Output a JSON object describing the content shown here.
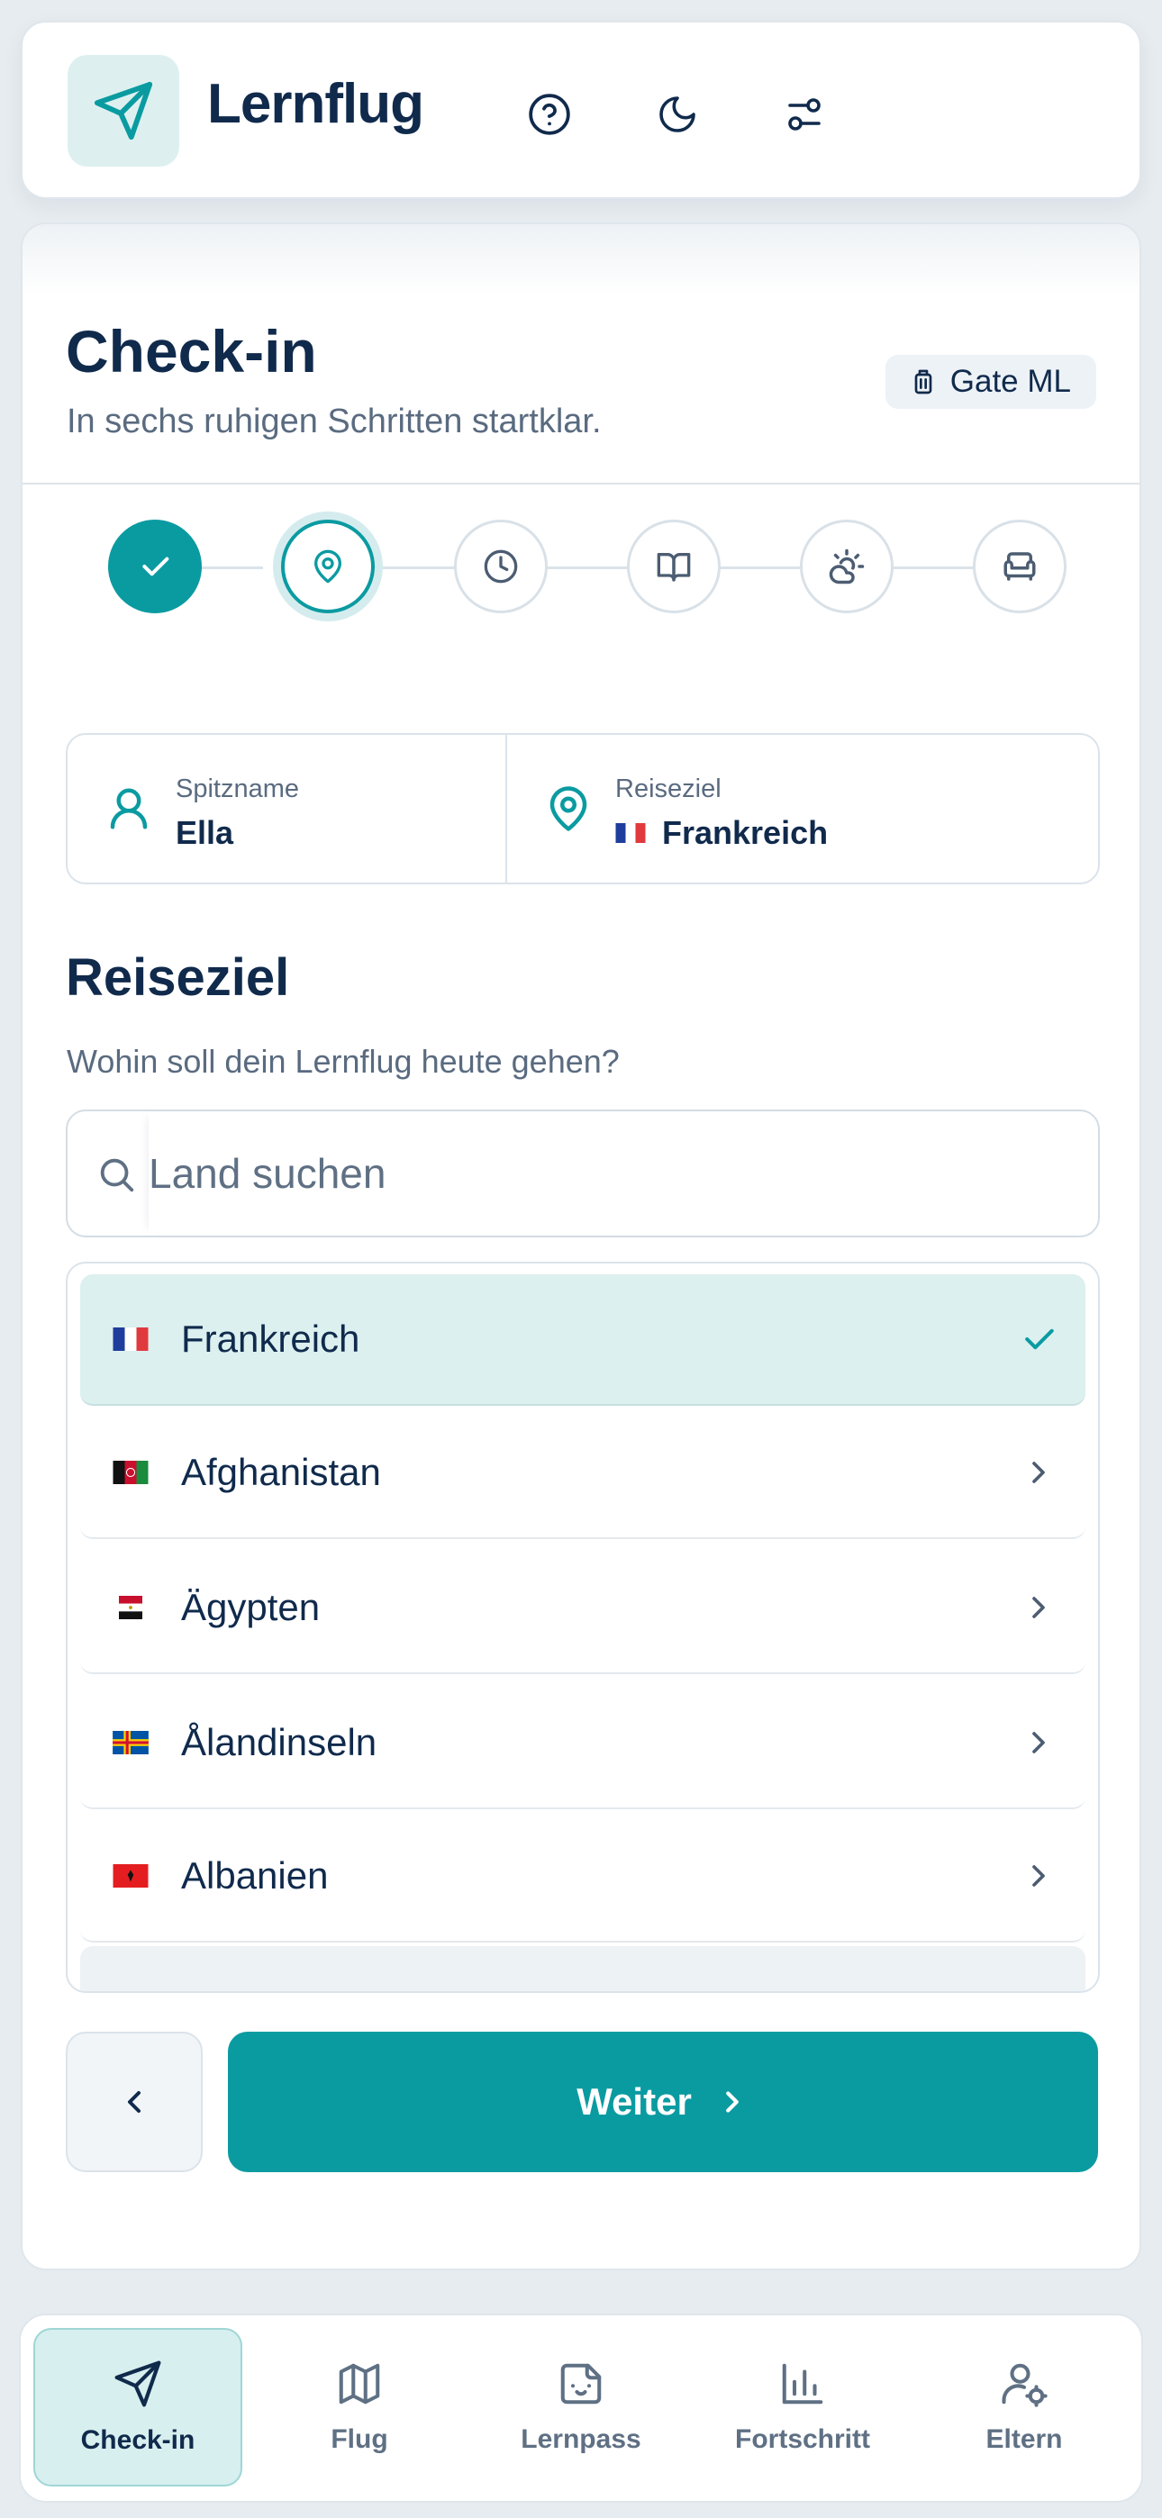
{
  "app": {
    "title": "Lernflug"
  },
  "header": {
    "icons": [
      "help-circle-icon",
      "moon-icon",
      "sliders-icon"
    ]
  },
  "checkin": {
    "title": "Check-in",
    "subtitle": "In sechs ruhigen Schritten startklar.",
    "gate_badge": "Gate ML",
    "steps": [
      {
        "icon": "check-icon",
        "state": "done"
      },
      {
        "icon": "map-pin-icon",
        "state": "active"
      },
      {
        "icon": "clock-icon",
        "state": "pending"
      },
      {
        "icon": "book-open-icon",
        "state": "pending"
      },
      {
        "icon": "cloud-sun-icon",
        "state": "pending"
      },
      {
        "icon": "armchair-icon",
        "state": "pending"
      }
    ],
    "summary": {
      "nickname_label": "Spitzname",
      "nickname_value": "Ella",
      "destination_label": "Reiseziel",
      "destination_value": "Frankreich"
    },
    "section_title": "Reiseziel",
    "section_subtitle": "Wohin soll dein Lernflug heute gehen?",
    "search_placeholder": "Land suchen",
    "countries": [
      {
        "name": "Frankreich",
        "selected": true,
        "flag": "flag-france-icon"
      },
      {
        "name": "Afghanistan",
        "selected": false,
        "flag": "flag-afghanistan-icon"
      },
      {
        "name": "Ägypten",
        "selected": false,
        "flag": "flag-egypt-icon"
      },
      {
        "name": "Ålandinseln",
        "selected": false,
        "flag": "flag-aland-icon"
      },
      {
        "name": "Albanien",
        "selected": false,
        "flag": "flag-albania-icon"
      }
    ],
    "next_label": "Weiter"
  },
  "nav": [
    {
      "label": "Check-in",
      "icon": "send-icon",
      "active": true
    },
    {
      "label": "Flug",
      "icon": "map-icon",
      "active": false
    },
    {
      "label": "Lernpass",
      "icon": "sticker-icon",
      "active": false
    },
    {
      "label": "Fortschritt",
      "icon": "bar-chart-icon",
      "active": false
    },
    {
      "label": "Eltern",
      "icon": "user-cog-icon",
      "active": false
    }
  ],
  "colors": {
    "accent": "#0a9ba1",
    "text": "#102a4c",
    "muted": "#5a6b80",
    "selected_bg": "#dbf0ef"
  }
}
